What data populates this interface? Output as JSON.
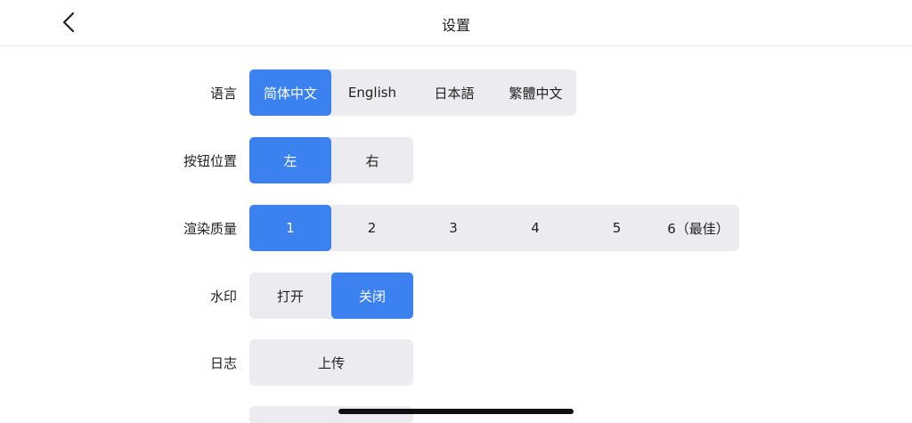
{
  "header": {
    "title": "设置",
    "back_icon": "chevron-left-icon"
  },
  "settings": {
    "language": {
      "label": "语言",
      "options": [
        "简体中文",
        "English",
        "日本語",
        "繁體中文"
      ],
      "selected": "简体中文"
    },
    "button_position": {
      "label": "按钮位置",
      "options": [
        "左",
        "右"
      ],
      "selected": "左"
    },
    "render_quality": {
      "label": "渲染质量",
      "options": [
        "1",
        "2",
        "3",
        "4",
        "5",
        "6（最佳）"
      ],
      "selected": "1"
    },
    "watermark": {
      "label": "水印",
      "options": [
        "打开",
        "关闭"
      ],
      "selected": "关闭"
    },
    "log": {
      "label": "日志",
      "button": "上传"
    }
  },
  "colors": {
    "accent": "#3b82f0",
    "segment_bg": "#ebebf0"
  }
}
